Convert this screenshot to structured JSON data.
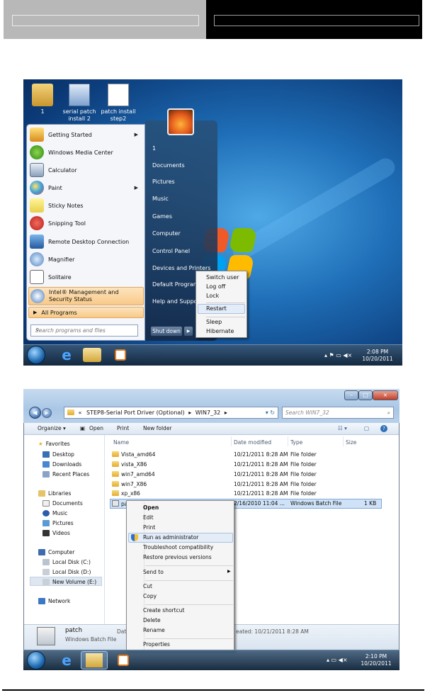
{
  "desktop": {
    "icons": [
      {
        "label": "1",
        "icon": "user-folder-icon"
      },
      {
        "label": "serial patch install 2",
        "icon": "batch-window-icon"
      },
      {
        "label": "patch install step2",
        "icon": "document-icon"
      }
    ]
  },
  "start_menu": {
    "left_items": [
      {
        "label": "Getting Started",
        "icon": "getting-started-icon",
        "has_submenu": true
      },
      {
        "label": "Windows Media Center",
        "icon": "media-center-icon",
        "has_submenu": false
      },
      {
        "label": "Calculator",
        "icon": "calculator-icon",
        "has_submenu": false
      },
      {
        "label": "Paint",
        "icon": "paint-icon",
        "has_submenu": true
      },
      {
        "label": "Sticky Notes",
        "icon": "sticky-notes-icon",
        "has_submenu": false
      },
      {
        "label": "Snipping Tool",
        "icon": "snipping-tool-icon",
        "has_submenu": false
      },
      {
        "label": "Remote Desktop Connection",
        "icon": "remote-desktop-icon",
        "has_submenu": false
      },
      {
        "label": "Magnifier",
        "icon": "magnifier-icon",
        "has_submenu": false
      },
      {
        "label": "Solitaire",
        "icon": "solitaire-icon",
        "has_submenu": false
      },
      {
        "label": "Intel® Management and Security Status",
        "icon": "intel-icon",
        "has_submenu": false
      }
    ],
    "all_programs": "All Programs",
    "search_placeholder": "Search programs and files",
    "right_items": [
      "1",
      "Documents",
      "Pictures",
      "Music",
      "Games",
      "Computer",
      "Control Panel",
      "Devices and Printers",
      "Default Programs",
      "Help and Support"
    ],
    "shutdown_label": "Shut down",
    "shutdown_menu": [
      "Switch user",
      "Log off",
      "Lock",
      "Restart",
      "Sleep",
      "Hibernate"
    ],
    "shutdown_highlighted": "Restart"
  },
  "taskbar1": {
    "time": "2:08 PM",
    "date": "10/20/2011"
  },
  "explorer": {
    "breadcrumb": [
      "«",
      "STEP8-Serial Port Driver (Optional)",
      "WIN7_32"
    ],
    "search_placeholder": "Search WIN7_32",
    "toolbar": [
      "Organize ▾",
      "Open",
      "Print",
      "New folder"
    ],
    "nav": {
      "favorites_header": "Favorites",
      "favorites": [
        "Desktop",
        "Downloads",
        "Recent Places"
      ],
      "libraries_header": "Libraries",
      "libraries": [
        "Documents",
        "Music",
        "Pictures",
        "Videos"
      ],
      "computer_header": "Computer",
      "drives": [
        "Local Disk (C:)",
        "Local Disk (D:)",
        "New Volume (E:)"
      ],
      "network": "Network"
    },
    "columns": [
      "Name",
      "Date modified",
      "Type",
      "Size"
    ],
    "rows": [
      {
        "name": "Vista_amd64",
        "date": "10/21/2011 8:28 AM",
        "type": "File folder",
        "size": ""
      },
      {
        "name": "vista_X86",
        "date": "10/21/2011 8:28 AM",
        "type": "File folder",
        "size": ""
      },
      {
        "name": "win7_amd64",
        "date": "10/21/2011 8:28 AM",
        "type": "File folder",
        "size": ""
      },
      {
        "name": "win7_X86",
        "date": "10/21/2011 8:28 AM",
        "type": "File folder",
        "size": ""
      },
      {
        "name": "xp_x86",
        "date": "10/21/2011 8:28 AM",
        "type": "File folder",
        "size": ""
      },
      {
        "name": "pa",
        "date": "2/16/2010 11:04 ...",
        "type": "Windows Batch File",
        "size": "1 KB"
      }
    ],
    "details": {
      "name": "patch",
      "type": "Windows Batch File",
      "date_label": "Date",
      "created": "eated: 10/21/2011 8:28 AM"
    },
    "context_menu": {
      "group1": [
        "Open",
        "Edit",
        "Print",
        "Run as administrator",
        "Troubleshoot compatibility",
        "Restore previous versions"
      ],
      "send_to": "Send to",
      "group2": [
        "Cut",
        "Copy"
      ],
      "group3": [
        "Create shortcut",
        "Delete",
        "Rename"
      ],
      "group4": [
        "Properties"
      ],
      "highlighted": "Run as administrator"
    }
  },
  "taskbar2": {
    "time": "2:10 PM",
    "date": "10/20/2011"
  }
}
